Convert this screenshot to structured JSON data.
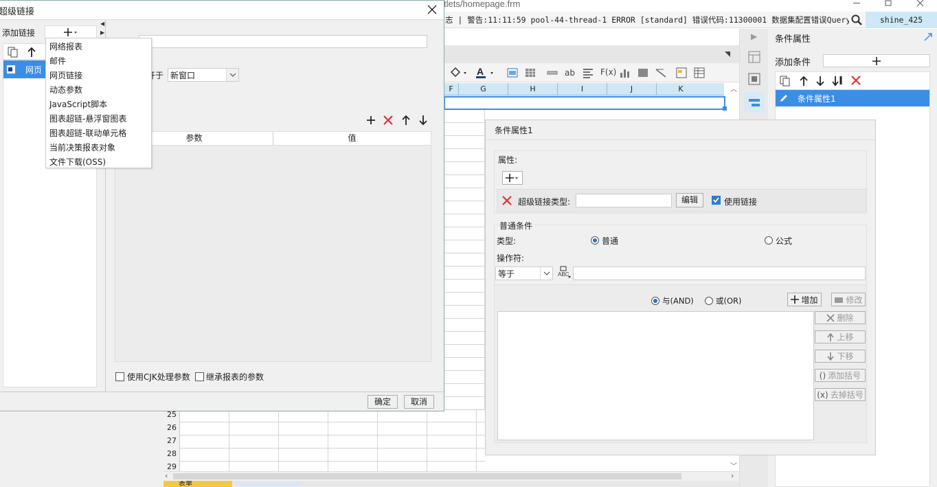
{
  "app": {
    "window_title": "tlets/homepage.frm",
    "log_text": "志 | 警告:11:11:59 pool-44-thread-1 ERROR [standard] 错误代码:11300001 数据集配置错误Query:java...",
    "user": "shine_425"
  },
  "grid": {
    "columns": [
      "F",
      "G",
      "H",
      "I",
      "J",
      "K"
    ],
    "rows": [
      "25",
      "26",
      "27",
      "28",
      "29"
    ],
    "sheet_tab": "表单"
  },
  "right_panel": {
    "title": "条件属性",
    "add_condition_label": "添加条件",
    "items": [
      "条件属性1"
    ]
  },
  "condition_panel": {
    "title": "条件属性1",
    "attr_label": "属性:",
    "link_type_label": "超级链接类型:",
    "edit_button": "编辑",
    "use_link_label": "使用链接",
    "normal_condition": "普通条件",
    "type_label": "类型:",
    "type_normal": "普通",
    "type_formula": "公式",
    "operator_label": "操作符:",
    "operator_value": "等于",
    "and_label": "与(AND)",
    "or_label": "或(OR)",
    "add_button": "增加",
    "modify_button": "修改",
    "delete_button": "删除",
    "up_button": "上移",
    "down_button": "下移",
    "add_bracket_button": "添加括号",
    "remove_bracket_button": "去掉括号"
  },
  "dialog": {
    "title": "超级链接",
    "add_link_label": "添加链接",
    "list_item": "网页",
    "open_in_label": "开于",
    "open_in_value": "新窗口",
    "table_headers": [
      "参数",
      "值"
    ],
    "cjk_label": "使用CJK处理参数",
    "inherit_label": "继承报表的参数",
    "ok_button": "确定",
    "cancel_button": "取消"
  },
  "menu": {
    "items": [
      "网络报表",
      "邮件",
      "网页链接",
      "动态参数",
      "JavaScript脚本",
      "图表超链-悬浮窗图表",
      "图表超链-联动单元格",
      "当前决策报表对象",
      "文件下载(OSS)"
    ]
  },
  "colors": {
    "accent": "#3c8de0",
    "selected": "#3a8ee6",
    "delete_red": "#e03030",
    "header_cyan": "#cfe8f5",
    "user_bg": "#cde8f7"
  }
}
